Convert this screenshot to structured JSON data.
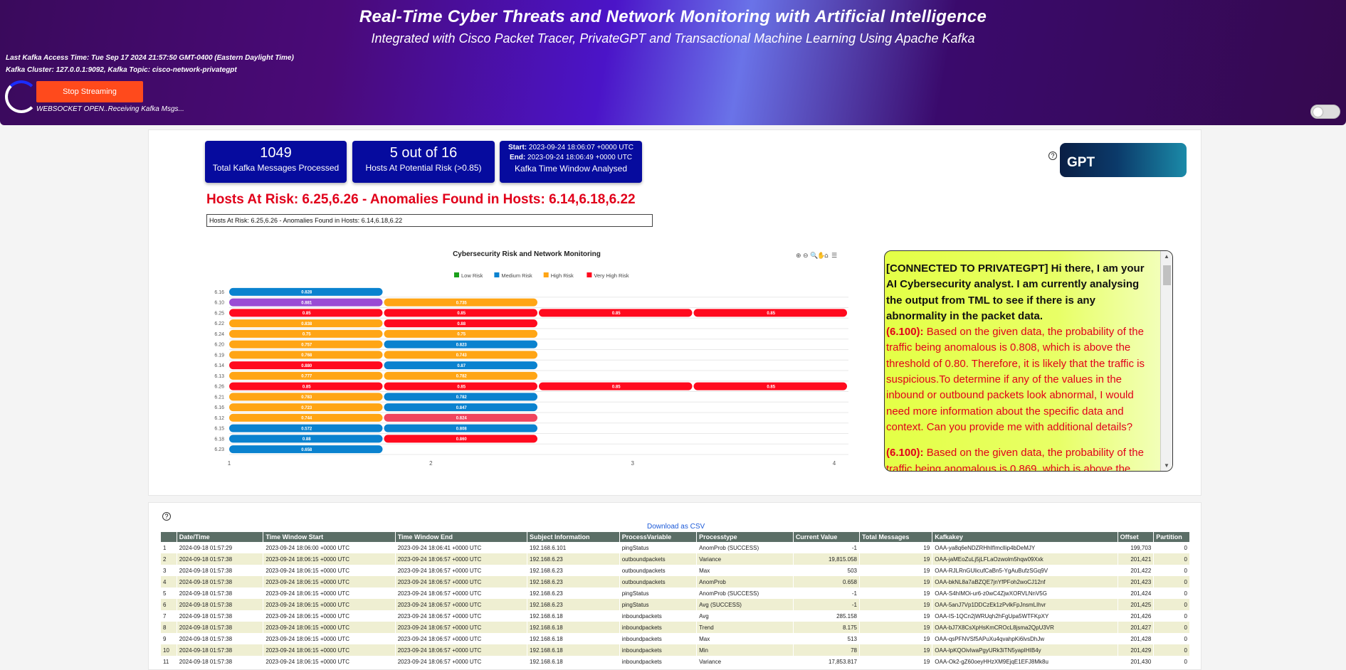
{
  "header": {
    "title": "Real-Time Cyber Threats and Network Monitoring with Artificial Intelligence",
    "subtitle": "Integrated with Cisco Packet Tracer, PrivateGPT and Transactional Machine Learning Using Apache Kafka",
    "kafka_access": "Last Kafka Access Time: Tue Sep 17 2024 21:57:50 GMT-0400 (Eastern Daylight Time)",
    "kafka_cluster": "Kafka Cluster: 127.0.0.1:9092, Kafka Topic: cisco-network-privategpt",
    "stop_button": "Stop Streaming",
    "ws_status": "WEBSOCKET OPEN..Receiving Kafka Msgs..."
  },
  "cards": {
    "total_value": "1049",
    "total_label": "Total Kafka Messages Processed",
    "risk_value": "5 out of 16",
    "risk_label": "Hosts At Potential Risk (>0.85)",
    "start_label": "Start:",
    "start_value": "2023-09-24 18:06:07 +0000 UTC",
    "end_label": "End:",
    "end_value": "2023-09-24 18:06:49 +0000 UTC",
    "window_label": "Kafka Time Window Analysed"
  },
  "gpt": {
    "logo_text": "GPT",
    "help": "?"
  },
  "risk": {
    "title": "Hosts At Risk: 6.25,6.26 - Anomalies Found in Hosts: 6.14,6.18,6.22",
    "input_value": "Hosts At Risk: 6.25,6.26 - Anomalies Found in Hosts: 6.14,6.18,6.22"
  },
  "chart_data": {
    "type": "bar",
    "title": "Cybersecurity Risk and Network Monitoring",
    "legend": [
      "Low Risk",
      "Medium Risk",
      "High Risk",
      "Very High Risk"
    ],
    "colors": {
      "Low Risk": "#1aa01a",
      "Medium Risk": "#0a82cf",
      "High Risk": "#ffa515",
      "Very High Risk": "#ff0a1e"
    },
    "x_ticks": [
      "1",
      "2",
      "3",
      "4"
    ],
    "rows": [
      {
        "host": "6.16",
        "bars": [
          {
            "v": "0.828",
            "c": "Medium Risk"
          }
        ]
      },
      {
        "host": "6.10",
        "bars": [
          {
            "v": "0.881",
            "c": "purple"
          },
          {
            "v": "0.735",
            "c": "High Risk"
          }
        ]
      },
      {
        "host": "6.25",
        "bars": [
          {
            "v": "0.85",
            "c": "Very High Risk"
          },
          {
            "v": "0.85",
            "c": "Very High Risk"
          },
          {
            "v": "0.85",
            "c": "Very High Risk"
          },
          {
            "v": "0.85",
            "c": "Very High Risk"
          }
        ]
      },
      {
        "host": "6.22",
        "bars": [
          {
            "v": "0.838",
            "c": "High Risk"
          },
          {
            "v": "0.88",
            "c": "Very High Risk"
          }
        ]
      },
      {
        "host": "6.24",
        "bars": [
          {
            "v": "0.75",
            "c": "High Risk"
          },
          {
            "v": "0.75",
            "c": "High Risk"
          }
        ]
      },
      {
        "host": "6.20",
        "bars": [
          {
            "v": "0.757",
            "c": "High Risk"
          },
          {
            "v": "0.823",
            "c": "Medium Risk"
          }
        ]
      },
      {
        "host": "6.19",
        "bars": [
          {
            "v": "0.768",
            "c": "High Risk"
          },
          {
            "v": "0.743",
            "c": "High Risk"
          }
        ]
      },
      {
        "host": "6.14",
        "bars": [
          {
            "v": "0.880",
            "c": "Very High Risk"
          },
          {
            "v": "0.87",
            "c": "Medium Risk"
          }
        ]
      },
      {
        "host": "6.13",
        "bars": [
          {
            "v": "0.777",
            "c": "High Risk"
          },
          {
            "v": "0.782",
            "c": "High Risk"
          }
        ]
      },
      {
        "host": "6.26",
        "bars": [
          {
            "v": "0.85",
            "c": "Very High Risk"
          },
          {
            "v": "0.85",
            "c": "Very High Risk"
          },
          {
            "v": "0.85",
            "c": "Very High Risk"
          },
          {
            "v": "0.85",
            "c": "Very High Risk"
          }
        ]
      },
      {
        "host": "6.21",
        "bars": [
          {
            "v": "0.783",
            "c": "High Risk"
          },
          {
            "v": "0.782",
            "c": "Medium Risk"
          }
        ]
      },
      {
        "host": "6.16",
        "bars": [
          {
            "v": "0.723",
            "c": "High Risk"
          },
          {
            "v": "0.847",
            "c": "Medium Risk"
          }
        ]
      },
      {
        "host": "6.12",
        "bars": [
          {
            "v": "0.744",
            "c": "High Risk"
          },
          {
            "v": "0.824",
            "c": "pink"
          }
        ]
      },
      {
        "host": "6.15",
        "bars": [
          {
            "v": "0.572",
            "c": "Medium Risk"
          },
          {
            "v": "0.808",
            "c": "Medium Risk"
          }
        ]
      },
      {
        "host": "6.18",
        "bars": [
          {
            "v": "0.88",
            "c": "Medium Risk"
          },
          {
            "v": "0.860",
            "c": "Very High Risk"
          }
        ]
      },
      {
        "host": "6.23",
        "bars": [
          {
            "v": "0.658",
            "c": "Medium Risk"
          }
        ]
      }
    ]
  },
  "chat": {
    "hello": "[CONNECTED TO PRIVATEGPT] Hi there, I am your AI Cybersecurity analyst. I am currently analysing the output from TML to see if there is any abnormality in the packet data.",
    "m1_host": "(6.100):",
    "m1_text": " Based on the given data, the probability of the traffic being anomalous is 0.808, which is above the threshold of 0.80. Therefore, it is likely that the traffic is suspicious.To determine if any of the values in the inbound or outbound packets look abnormal, I would need more information about the specific data and context. Can you provide me with additional details?",
    "m2_host": "(6.100):",
    "m2_text": " Based on the given data, the probability of the traffic being anomalous is 0.869, which is above the"
  },
  "table": {
    "csv_link": "Download as CSV",
    "help": "?",
    "columns": [
      "",
      "Date/Time",
      "Time Window Start",
      "Time Window End",
      "Subject Information",
      "ProcessVariable",
      "Processtype",
      "Current Value",
      "Total Messages",
      "Kafkakey",
      "Offset",
      "Partition"
    ],
    "rows": [
      [
        "1",
        "2024-09-18 01:57:29",
        "2023-09-24 18:06:00 +0000 UTC",
        "2023-09-24 18:06:41 +0000 UTC",
        "192.168.6.101",
        "pingStatus",
        "AnomProb (SUCCESS)",
        "-1",
        "19",
        "OAA-ya8q6eNDZRHhIfImclIip4bDeMJY",
        "199,703",
        "0"
      ],
      [
        "2",
        "2024-09-18 01:57:38",
        "2023-09-24 18:06:15 +0000 UTC",
        "2023-09-24 18:06:57 +0000 UTC",
        "192.168.6.23",
        "outboundpackets",
        "Variance",
        "19,815.058",
        "19",
        "OAA-jaMEoZuLj5jLFLaOzwolm5hqw09Xxk",
        "201,421",
        "0"
      ],
      [
        "3",
        "2024-09-18 01:57:38",
        "2023-09-24 18:06:15 +0000 UTC",
        "2023-09-24 18:06:57 +0000 UTC",
        "192.168.6.23",
        "outboundpackets",
        "Max",
        "503",
        "19",
        "OAA-RJLRnGUlicufCaBn5-YgAuBufzSGq9V",
        "201,422",
        "0"
      ],
      [
        "4",
        "2024-09-18 01:57:38",
        "2023-09-24 18:06:15 +0000 UTC",
        "2023-09-24 18:06:57 +0000 UTC",
        "192.168.6.23",
        "outboundpackets",
        "AnomProb",
        "0.658",
        "19",
        "OAA-bkNL8a7aBZQE7jnYfPFoh2woCJ12nf",
        "201,423",
        "0"
      ],
      [
        "5",
        "2024-09-18 01:57:38",
        "2023-09-24 18:06:15 +0000 UTC",
        "2023-09-24 18:06:57 +0000 UTC",
        "192.168.6.23",
        "pingStatus",
        "AnomProb (SUCCESS)",
        "-1",
        "19",
        "OAA-S4hIMOi-ur6-z0wC4ZjwXORVLNnV5G",
        "201,424",
        "0"
      ],
      [
        "6",
        "2024-09-18 01:57:38",
        "2023-09-24 18:06:15 +0000 UTC",
        "2023-09-24 18:06:57 +0000 UTC",
        "192.168.6.23",
        "pingStatus",
        "Avg (SUCCESS)",
        "-1",
        "19",
        "OAA-5anJ7Vp1DDCzEk1zPvlkFpJnsmLIhvr",
        "201,425",
        "0"
      ],
      [
        "7",
        "2024-09-18 01:57:38",
        "2023-09-24 18:06:15 +0000 UTC",
        "2023-09-24 18:06:57 +0000 UTC",
        "192.168.6.18",
        "inboundpackets",
        "Avg",
        "285.158",
        "19",
        "OAA-IS-1QCn2jWRUqh2hFgUpa5WTFKpXY",
        "201,426",
        "0"
      ],
      [
        "8",
        "2024-09-18 01:57:38",
        "2023-09-24 18:06:15 +0000 UTC",
        "2023-09-24 18:06:57 +0000 UTC",
        "192.168.6.18",
        "inboundpackets",
        "Trend",
        "8.175",
        "19",
        "OAA-bJ7X8CsXpHsKmCROcL8jsma2QpU3VR",
        "201,427",
        "0"
      ],
      [
        "9",
        "2024-09-18 01:57:38",
        "2023-09-24 18:06:15 +0000 UTC",
        "2023-09-24 18:06:57 +0000 UTC",
        "192.168.6.18",
        "inboundpackets",
        "Max",
        "513",
        "19",
        "OAA-qsPFNVSf5APuXu4qvahpKi6lvsDhJw",
        "201,428",
        "0"
      ],
      [
        "10",
        "2024-09-18 01:57:38",
        "2023-09-24 18:06:15 +0000 UTC",
        "2023-09-24 18:06:57 +0000 UTC",
        "192.168.6.18",
        "inboundpackets",
        "Min",
        "78",
        "19",
        "OAA-lpKQOivIwaPgyURk3iTN5yapIHIB4y",
        "201,429",
        "0"
      ],
      [
        "11",
        "2024-09-18 01:57:38",
        "2023-09-24 18:06:15 +0000 UTC",
        "2023-09-24 18:06:57 +0000 UTC",
        "192.168.6.18",
        "inboundpackets",
        "Variance",
        "17,853.817",
        "19",
        "OAA-Ok2-gZ60oeyHHzXM9EjqE1EFJ8Mk8u",
        "201,430",
        "0"
      ]
    ]
  }
}
